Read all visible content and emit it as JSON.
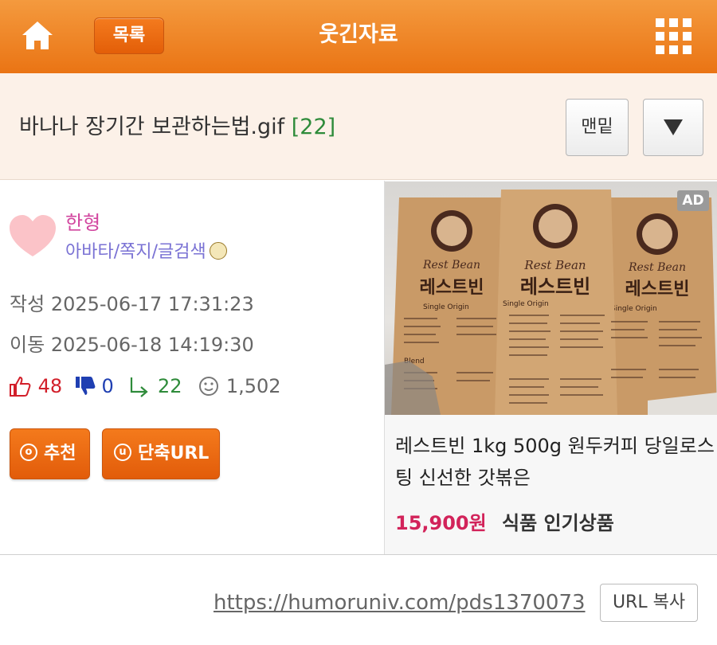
{
  "topbar": {
    "home_icon": "home-icon",
    "list_label": "목록",
    "title": "웃긴자료",
    "grid_icon": "grid-icon"
  },
  "post": {
    "title": "바나나 장기간 보관하는법.gif",
    "comment_count": "[22]",
    "bottom_label": "맨밑",
    "down_icon": "triangle-down-icon"
  },
  "author": {
    "name": "한형",
    "links": "아바타/쪽지/글검색"
  },
  "meta": {
    "written_label": "작성",
    "written_value": "2025-06-17 17:31:23",
    "moved_label": "이동",
    "moved_value": "2025-06-18 14:19:30"
  },
  "stats": {
    "upvotes": "48",
    "downvotes": "0",
    "replies": "22",
    "views": "1,502"
  },
  "actions": {
    "recommend_label": "추천",
    "shorturl_label": "단축URL"
  },
  "ad": {
    "badge": "AD",
    "brand_top": "Rest Bean",
    "brand_kor": "레스트빈",
    "bag_label1": "Single Origin",
    "bag_label2": "Blend",
    "text": "레스트빈 1kg 500g 원두커피 당일로스팅 신선한 갓볶은",
    "price": "15,900원",
    "category": "식품 인기상품"
  },
  "url": {
    "link": "https://humoruniv.com/pds1370073",
    "copy_label": "URL 복사"
  },
  "colors": {
    "topbar": "#ea7414",
    "button": "#e35e08",
    "author": "#d2469f",
    "links": "#7a72d4",
    "price": "#d2235a",
    "reply_count": "#2e8b3a"
  }
}
